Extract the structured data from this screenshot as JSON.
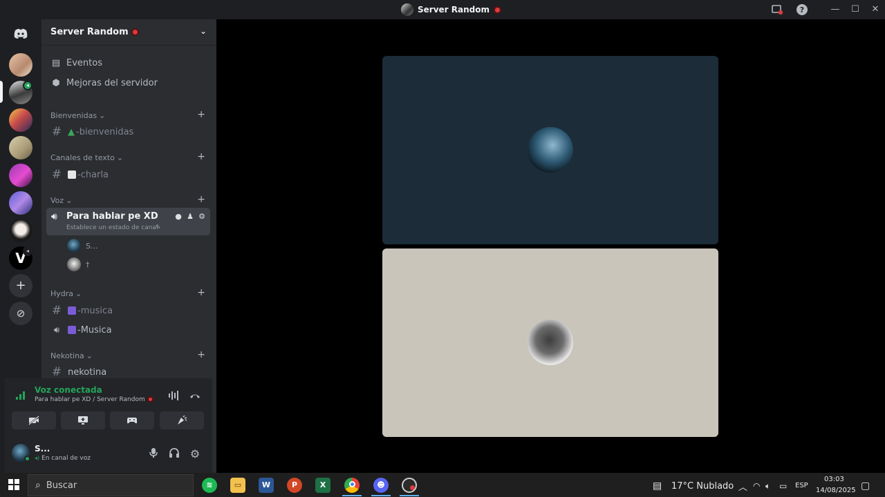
{
  "window": {
    "title": "Server Random"
  },
  "sidebar": {
    "server_name": "Server Random",
    "nav": [
      {
        "label": "Eventos",
        "icon": "calendar-icon"
      },
      {
        "label": "Mejoras del servidor",
        "icon": "boost-icon"
      }
    ],
    "categories": {
      "bienvenidas": {
        "label": "Bienvenidas",
        "channel": "-bienvenidas"
      },
      "texto": {
        "label": "Canales de texto",
        "channel": "-charla"
      },
      "voz": {
        "label": "Voz"
      },
      "hydra": {
        "label": "Hydra",
        "channels": [
          "-musica",
          "-Musica"
        ]
      },
      "nekotina": {
        "label": "Nekotina",
        "channel": "nekotina"
      }
    },
    "voice_channel": {
      "name": "Para hablar pe XD",
      "status_placeholder": "Establece un estado de canal",
      "users": [
        "S...",
        "†"
      ]
    }
  },
  "voice_panel": {
    "title": "Voz conectada",
    "subtitle": "Para hablar pe XD / Server Random"
  },
  "user_panel": {
    "name": "S...",
    "status": "En canal de voz"
  },
  "taskbar": {
    "search_placeholder": "Buscar",
    "weather": "17°C  Nublado",
    "language": "ESP",
    "time": "03:03",
    "date": "14/08/2025"
  },
  "colors": {
    "accent_green": "#23a55a",
    "tile_top": "#1c2c38",
    "tile_bottom": "#c9c5bb",
    "sidebar": "#2b2d31",
    "rail": "#1e1f22"
  }
}
